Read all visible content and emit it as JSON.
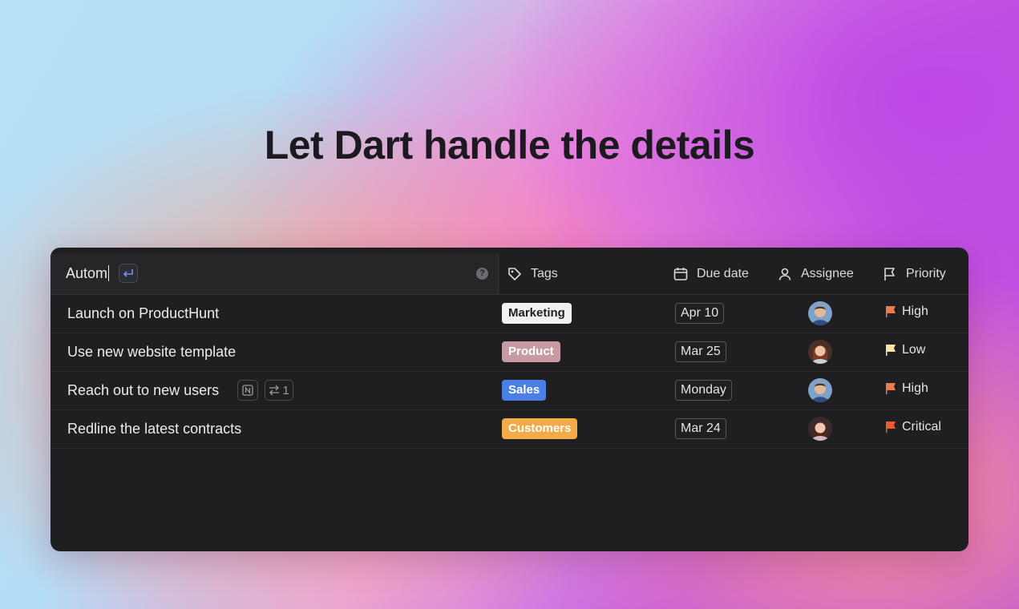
{
  "headline": "Let Dart handle the details",
  "search": {
    "value": "Autom"
  },
  "columns": {
    "tags": "Tags",
    "due_date": "Due date",
    "assignee": "Assignee",
    "priority": "Priority"
  },
  "tasks": [
    {
      "title": "Launch on ProductHunt",
      "tag": "Marketing",
      "tag_bg": "#f1f0f2",
      "tag_fg": "#1f1f21",
      "due": "Apr 10",
      "assignee_avatar": "avatar-man",
      "priority": "High",
      "priority_color": "#f07a4a"
    },
    {
      "title": "Use new website template",
      "tag": "Product",
      "tag_bg": "#c89aa4",
      "tag_fg": "#ffffff",
      "due": "Mar 25",
      "assignee_avatar": "avatar-woman",
      "priority": "Low",
      "priority_color": "#f7e6a8"
    },
    {
      "title": "Reach out to new users",
      "tag": "Sales",
      "tag_bg": "#4c7fe6",
      "tag_fg": "#ffffff",
      "due": "Monday",
      "assignee_avatar": "avatar-man",
      "priority": "High",
      "priority_color": "#f07a4a",
      "link_count": "1"
    },
    {
      "title": "Redline the latest contracts",
      "tag": "Customers",
      "tag_bg": "#f3aa48",
      "tag_fg": "#ffffff",
      "due": "Mar 24",
      "assignee_avatar": "avatar-woman-2",
      "priority": "Critical",
      "priority_color": "#ea5a2e"
    }
  ]
}
